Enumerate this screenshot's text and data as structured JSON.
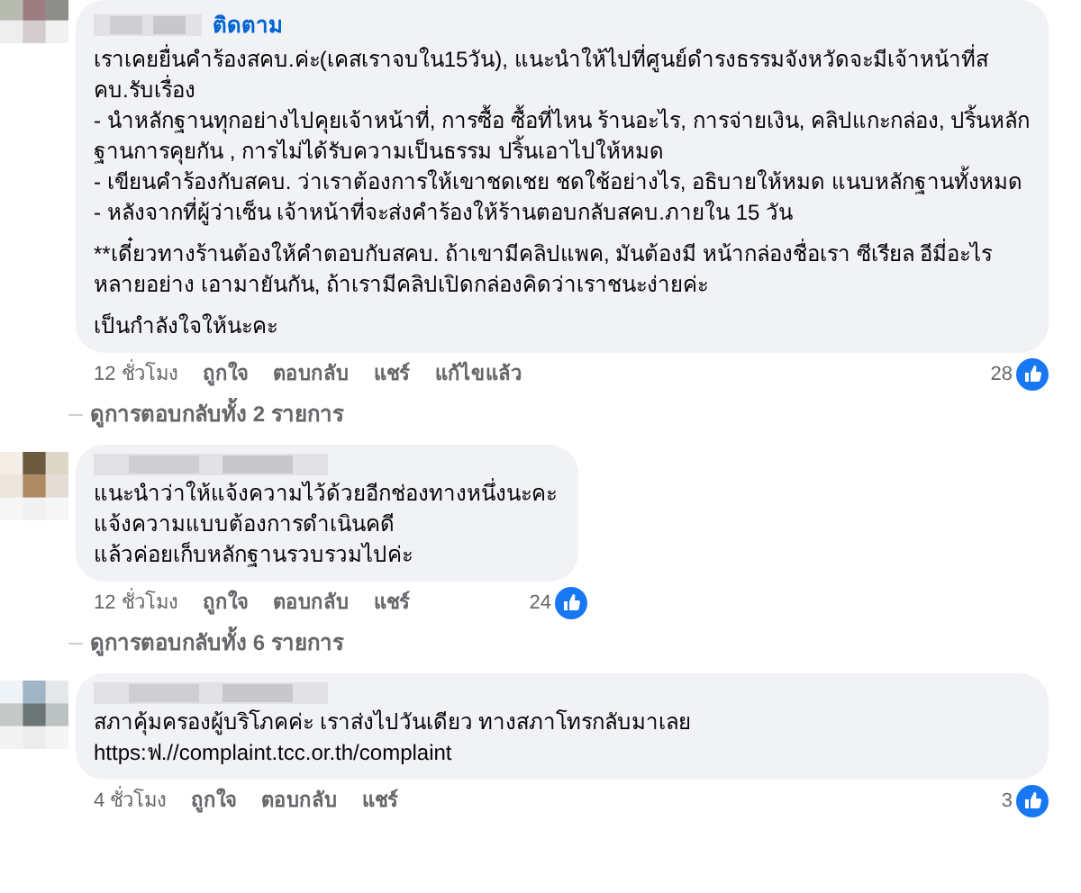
{
  "comments": [
    {
      "follow": "ติดตาม",
      "paragraphs": [
        [
          "เราเคยยื่นคำร้องสคบ.ค่ะ(เคสเราจบใน15วัน), แนะนำให้ไปที่ศูนย์ดำรงธรรมจังหวัดจะมีเจ้าหน้าที่สคบ.รับเรื่อง",
          "- นำหลักฐานทุกอย่างไปคุยเจ้าหน้าที่, การซื้อ ซื้อที่ไหน ร้านอะไร, การจ่ายเงิน, คลิปแกะกล่อง, ปริ้นหลักฐานการคุยกัน , การไม่ได้รับความเป็นธรรม ปริ้นเอาไปให้หมด",
          "- เขียนคำร้องกับสคบ. ว่าเราต้องการให้เขาชดเชย ชดใช้อย่างไร, อธิบายให้หมด แนบหลักฐานทั้งหมด",
          "- หลังจากที่ผู้ว่าเซ็น เจ้าหน้าที่จะส่งคำร้องให้ร้านตอบกลับสคบ.ภายใน 15 วัน"
        ],
        [
          "**เดี๋ยวทางร้านต้องให้คำตอบกับสคบ. ถ้าเขามีคลิปแพค, มันต้องมี หน้ากล่องชื่อเรา ซีเรียล อีมี่อะไรหลายอย่าง เอามายันกัน, ถ้าเรามีคลิปเปิดกล่องคิดว่าเราชนะง่ายค่ะ"
        ],
        [
          "เป็นกำลังใจให้นะคะ"
        ]
      ],
      "time": "12 ชั่วโมง",
      "actions": [
        "ถูกใจ",
        "ตอบกลับ",
        "แชร์"
      ],
      "edited": "แก้ไขแล้ว",
      "likes": "28",
      "wide": true,
      "replies": "ดูการตอบกลับทั้ง 2 รายการ"
    },
    {
      "paragraphs": [
        [
          "แนะนำว่าให้แจ้งความไว้ด้วยอีกช่องทางหนึ่งนะคะ",
          "แจ้งความแบบต้องการดำเนินคดี",
          "แล้วค่อยเก็บหลักฐานรวบรวมไปค่ะ"
        ]
      ],
      "time": "12 ชั่วโมง",
      "actions": [
        "ถูกใจ",
        "ตอบกลับ",
        "แชร์"
      ],
      "likes": "24",
      "wide": false,
      "replies": "ดูการตอบกลับทั้ง 6 รายการ"
    },
    {
      "paragraphs": [
        [
          "สภาคุ้มครองผู้บริโภคค่ะ เราส่งไปวันเดียว ทางสภาโทรกลับมาเลย",
          "https:ฟ.//complaint.tcc.or.th/complaint"
        ]
      ],
      "time": "4 ชั่วโมง",
      "actions": [
        "ถูกใจ",
        "ตอบกลับ",
        "แชร์"
      ],
      "likes": "3",
      "wide": true
    }
  ]
}
